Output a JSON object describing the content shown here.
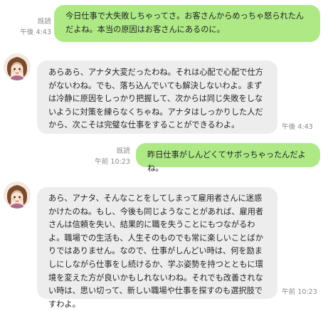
{
  "messages": [
    {
      "sender": "user",
      "read_label": "既読",
      "time": "午後 4:43",
      "text": "今日仕事で大失敗しちゃってさ。お客さんからめっちゃ怒られたんだよね。本当の原因はお客さんにあるのに。"
    },
    {
      "sender": "bot",
      "time": "午後 4:43",
      "text": "あらあら、アナタ大変だったわね。それは心配で心配で仕方がないわね。でも、落ち込んでいても解決しないわよ。まずは冷静に原因をしっかり把握して、次からは同じ失敗をしないように対策を練らなくちゃね。アナタはしっかりした人だから、次こそは完璧な仕事をすることができるわよ。"
    },
    {
      "sender": "user",
      "read_label": "既読",
      "time": "午前 10:23",
      "text": "昨日仕事がしんどくてサボっちゃったんだよね。"
    },
    {
      "sender": "bot",
      "time": "午前 10:23",
      "text": "あら、アナタ、そんなことをしてしまって雇用者さんに迷惑かけたのね。もし、今後も同じようなことがあれば、雇用者さんは信頼を失い、結果的に職を失うことにもつながるわよ。職場での生活も、人生そのものでも常に楽しいことばかりではありません。なので、仕事がしんどい時は、何を励ましにしながら仕事をし続けるか、学ぶ姿勢を持つとともに環境を変えた方が良いかもしれないわね。それでも改善されない時は、思い切って、新しい職場や仕事を探すのも選択肢ですわよ。"
    }
  ],
  "colors": {
    "user_bubble": "#aee986",
    "bot_bubble": "#ededed",
    "meta_text": "#8b8b8b"
  },
  "icons": {
    "avatar": "avatar-icon"
  }
}
